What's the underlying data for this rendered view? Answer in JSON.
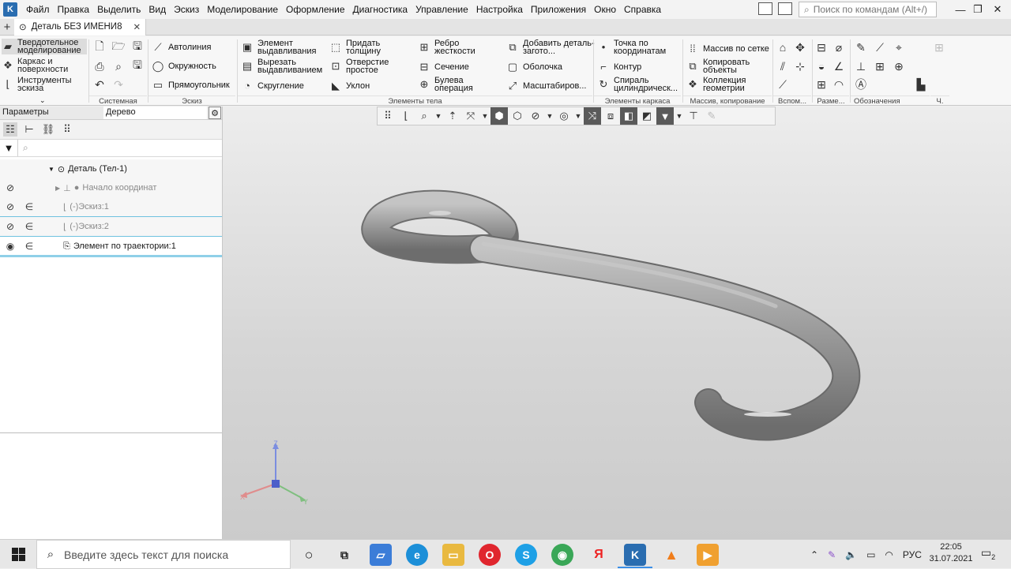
{
  "menu": {
    "items": [
      "Файл",
      "Правка",
      "Выделить",
      "Вид",
      "Эскиз",
      "Моделирование",
      "Оформление",
      "Диагностика",
      "Управление",
      "Настройка",
      "Приложения",
      "Окно",
      "Справка"
    ],
    "search_placeholder": "Поиск по командам (Alt+/)"
  },
  "tabs": {
    "document_title": "Деталь БЕЗ ИМЕНИ8"
  },
  "ribbon": {
    "modes": [
      "Твердотельное моделирование",
      "Каркас и поверхности",
      "Инструменты эскиза"
    ],
    "groups": {
      "system": "Системная",
      "sketch": "Эскиз",
      "body": "Элементы тела",
      "frame": "Элементы каркаса",
      "array": "Массив, копирование",
      "aux": "Вспом...",
      "size": "Разме...",
      "designations": "Обозначения",
      "ch": "Ч."
    },
    "sketch_buttons": [
      "Автолиния",
      "Окружность",
      "Прямоугольник"
    ],
    "body_col1": [
      "Элемент выдавливания",
      "Вырезать выдавливанием",
      "Скругление"
    ],
    "body_col2": [
      "Придать толщину",
      "Отверстие простое",
      "Уклон"
    ],
    "body_col3": [
      "Ребро жесткости",
      "Сечение",
      "Булева операция"
    ],
    "body_col4": [
      "Добавить деталь-загото...",
      "Оболочка",
      "Масштабиров..."
    ],
    "frame_buttons": [
      "Точка по координатам",
      "Контур",
      "Спираль цилиндрическ..."
    ],
    "array_buttons": [
      "Массив по сетке",
      "Копировать объекты",
      "Коллекция геометрии"
    ]
  },
  "panel": {
    "tab_params": "Параметры",
    "tab_tree": "Дерево",
    "search_placeholder": "",
    "tree": [
      {
        "label": "Деталь (Тел-1)",
        "muted": false
      },
      {
        "label": "Начало координат",
        "muted": true
      },
      {
        "label": "(-)Эскиз:1",
        "muted": true
      },
      {
        "label": "(-)Эскиз:2",
        "muted": true
      },
      {
        "label": "Элемент по траектории:1",
        "muted": false
      }
    ]
  },
  "viewport": {
    "axes": {
      "x": "X",
      "y": "Y",
      "z": "Z"
    }
  },
  "taskbar": {
    "search_placeholder": "Введите здесь текст для поиска",
    "language": "РУС",
    "time": "22:05",
    "date": "31.07.2021",
    "notifications": "2",
    "apps": [
      "cortana-icon",
      "task-view-icon",
      "app-icon",
      "edge-icon",
      "explorer-icon",
      "opera-icon",
      "skype-icon",
      "chrome-icon",
      "yandex-icon",
      "kompas-icon",
      "vlc-icon",
      "media-icon"
    ]
  },
  "colors": {
    "accent": "#3a8ee6",
    "model": "#9a9a9a",
    "selection_line": "#6fc2e0"
  }
}
